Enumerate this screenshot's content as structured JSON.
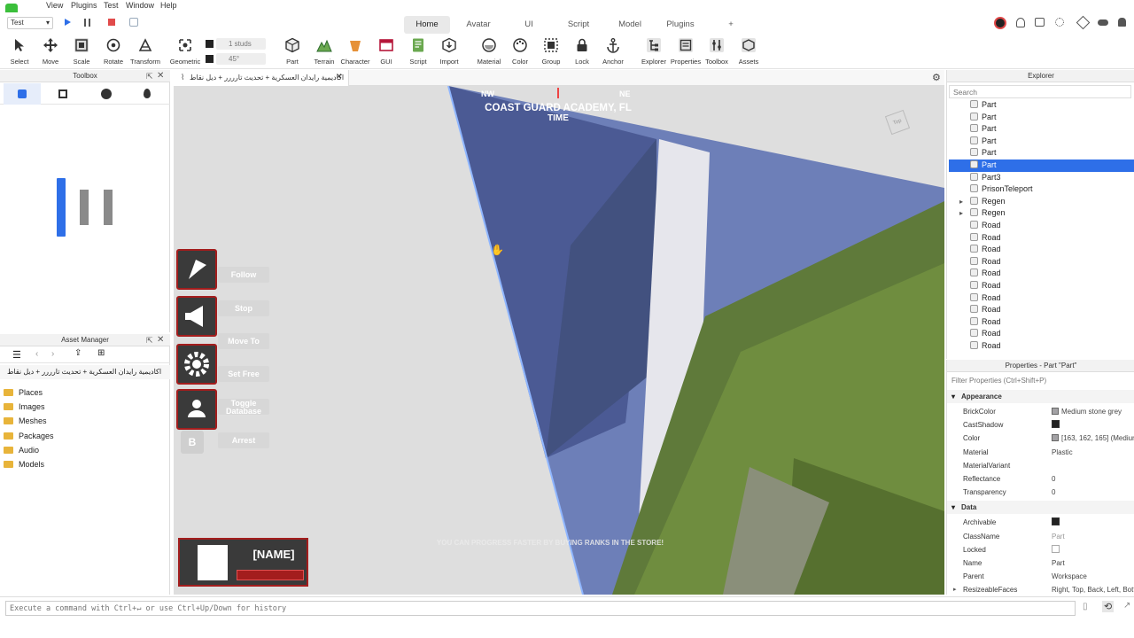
{
  "menubar": {
    "items": [
      "Test",
      "View",
      "Plugins",
      "Test",
      "Window",
      "Help"
    ]
  },
  "tabs": {
    "items": [
      "Home",
      "Avatar",
      "UI",
      "Script",
      "Model",
      "Plugins",
      "+"
    ],
    "active": "Home",
    "test_dropdown": "Test"
  },
  "ribbon": {
    "tools": [
      "Select",
      "Move",
      "Scale",
      "Rotate",
      "Transform",
      "Geometric",
      "Part",
      "Terrain",
      "Character",
      "GUI",
      "Script",
      "Import",
      "Material",
      "Color",
      "Group",
      "Lock",
      "Anchor",
      "Explorer",
      "Properties",
      "Toolbox",
      "Assets"
    ],
    "studs_label": "1 studs",
    "angle_label": "45°"
  },
  "toolbox": {
    "title": "Toolbox"
  },
  "asset_manager": {
    "title": "Asset Manager",
    "place_name": "اكاديمية رايدان العسكرية + تحديث تارررر + ديل نقاط",
    "items": [
      "Places",
      "Images",
      "Meshes",
      "Packages",
      "Audio",
      "Models"
    ]
  },
  "document_tab": {
    "label": "اكاديمية رايدان العسكرية + تحديث تارررر + ديل نقاط"
  },
  "viewport": {
    "compass_left": "NW",
    "compass_right": "NE",
    "banner_line1": "COAST GUARD ACADEMY, FL",
    "banner_line2": "TIME",
    "bottom_text": "YOU CAN PROGRESS FASTER BY BUYING RANKS IN THE STORE!",
    "view_cube_label": "Top",
    "game_buttons": [
      "Follow",
      "Stop",
      "Move To",
      "Set Free",
      "Toggle Database",
      "Arrest"
    ],
    "arrest_key": "B",
    "player_name": "[NAME]"
  },
  "explorer": {
    "title": "Explorer",
    "search_placeholder": "Search",
    "rows": [
      "Part",
      "Part",
      "Part",
      "Part",
      "Part",
      "Part",
      "Part3",
      "PrisonTeleport",
      "Regen",
      "Regen",
      "Road",
      "Road",
      "Road",
      "Road",
      "Road",
      "Road",
      "Road",
      "Road",
      "Road",
      "Road",
      "Road"
    ],
    "selected_index": 5
  },
  "properties": {
    "title": "Properties - Part \"Part\"",
    "filter_placeholder": "Filter Properties (Ctrl+Shift+P)",
    "sections": [
      {
        "name": "Appearance",
        "rows": [
          {
            "k": "BrickColor",
            "v": "Medium stone grey"
          },
          {
            "k": "CastShadow",
            "v": ""
          },
          {
            "k": "Color",
            "v": "[163, 162, 165] (Medium"
          },
          {
            "k": "Material",
            "v": "Plastic"
          },
          {
            "k": "MaterialVariant",
            "v": ""
          },
          {
            "k": "Reflectance",
            "v": "0"
          },
          {
            "k": "Transparency",
            "v": "0"
          }
        ]
      },
      {
        "name": "Data",
        "rows": [
          {
            "k": "Archivable",
            "v": ""
          },
          {
            "k": "ClassName",
            "v": "Part"
          },
          {
            "k": "Locked",
            "v": ""
          },
          {
            "k": "Name",
            "v": "Part"
          },
          {
            "k": "Parent",
            "v": "Workspace"
          },
          {
            "k": "ResizeableFaces",
            "v": "Right, Top, Back, Left, Bottom"
          }
        ]
      }
    ]
  },
  "command_bar": {
    "placeholder": "Execute a command with Ctrl+↵ or use Ctrl+Up/Down for history"
  },
  "colors": {
    "accent": "#2e6fe8",
    "gui_red": "#a31d1d"
  }
}
